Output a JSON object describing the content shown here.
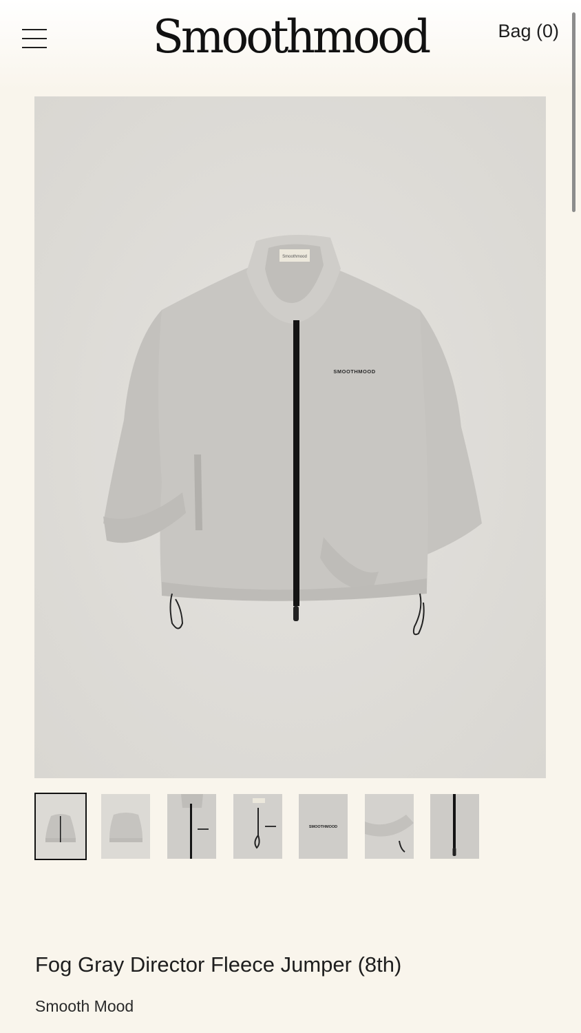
{
  "header": {
    "logo": "Smoothmood",
    "bag_label": "Bag (0)"
  },
  "product_image": {
    "neck_label": "Smoothmood",
    "chest_logo": "SMOOTHMOOD"
  },
  "thumbnails": [
    {
      "view": "front"
    },
    {
      "view": "back"
    },
    {
      "view": "collar-front"
    },
    {
      "view": "collar-label"
    },
    {
      "view": "logo-closeup",
      "text": "SMOOTHMOOD"
    },
    {
      "view": "cuff-drawcord"
    },
    {
      "view": "zipper"
    }
  ],
  "product": {
    "title": "Fog Gray Director Fleece Jumper (8th)",
    "brand": "Smooth Mood"
  },
  "colors": {
    "background": "#f9f5ec",
    "image_bg": "#dedcd7",
    "fleece": "#c6c4c0",
    "zipper": "#141414"
  },
  "icons": {
    "menu": "hamburger-menu-icon"
  }
}
